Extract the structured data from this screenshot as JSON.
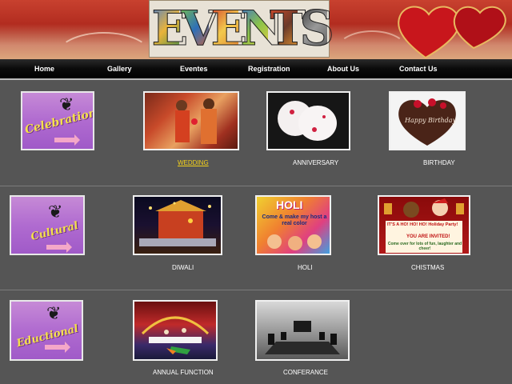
{
  "header": {
    "logo_letters": [
      "E",
      "V",
      "E",
      "N",
      "T",
      "S"
    ]
  },
  "nav": {
    "items": [
      "Home",
      "Gallery",
      "Eventes",
      "Registration",
      "About Us",
      "Contact Us"
    ]
  },
  "categories": [
    {
      "label": "Celebration",
      "items": [
        "WEDDING",
        "ANNIVERSARY",
        "BIRTHDAY"
      ]
    },
    {
      "label": "Cultural",
      "items": [
        "DIWALI",
        "HOLI",
        "CHISTMAS"
      ]
    },
    {
      "label": "Eductional",
      "items": [
        "ANNUAL FUNCTION",
        "CONFERANCE"
      ]
    }
  ],
  "thumb_text": {
    "birthday_cake": "Happy Birthday",
    "holi_title": "HOLI",
    "holi_sub": "Come & make my host a real color",
    "xmas_line1": "IT'S A HO! HO! HO! Holiday Party!",
    "xmas_line2": "YOU ARE INVITED!",
    "xmas_line3": "Come over for lots of fun, laughter and cheer!"
  },
  "colors": {
    "page_bg": "#555555",
    "nav_bg": "#000000",
    "link_active": "#f5d21a",
    "category_bg": "#b06bd0",
    "category_text": "#f4e14a"
  }
}
